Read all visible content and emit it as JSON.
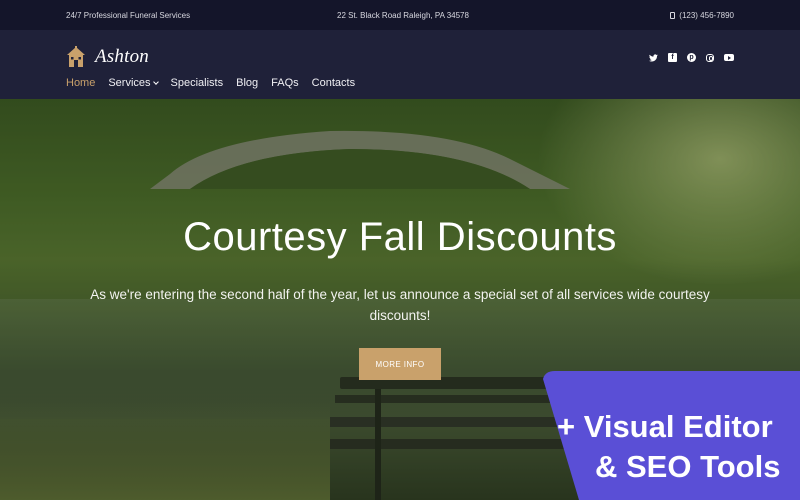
{
  "topbar": {
    "tagline": "24/7 Professional Funeral Services",
    "address": "22 St. Black Road Raleigh, PA 34578",
    "phone": "(123) 456-7890"
  },
  "header": {
    "logo_text": "Ashton",
    "nav": [
      {
        "label": "Home",
        "active": true
      },
      {
        "label": "Services",
        "has_dropdown": true
      },
      {
        "label": "Specialists"
      },
      {
        "label": "Blog"
      },
      {
        "label": "FAQs"
      },
      {
        "label": "Contacts"
      }
    ],
    "social": [
      "twitter-icon",
      "facebook-icon",
      "pinterest-icon",
      "instagram-icon",
      "youtube-icon"
    ]
  },
  "hero": {
    "title": "Courtesy Fall Discounts",
    "text": "As we're entering the second half of the year, let us announce a special set of all services wide courtesy discounts!",
    "button_label": "MORE INFO"
  },
  "promo": {
    "line1": "+ Visual Editor",
    "line2": "& SEO Tools"
  },
  "colors": {
    "accent": "#c9a16b",
    "header_bg": "#1f2139",
    "topbar_bg": "#14152a",
    "promo_bg": "#5a4fd6"
  }
}
